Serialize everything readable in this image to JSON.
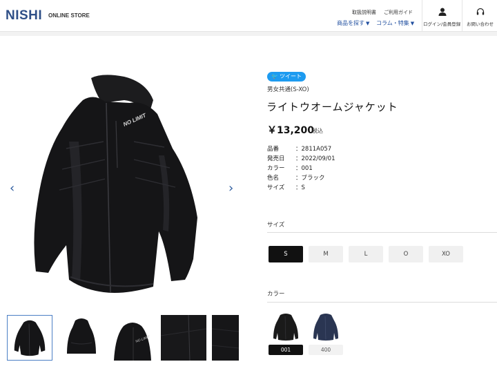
{
  "header": {
    "logo": "NISHI",
    "logo_sub": "ONLINE STORE",
    "links": [
      "取扱説明書",
      "ご利用ガイド"
    ],
    "nav": [
      "商品を探す",
      "コラム・特集"
    ],
    "login_label": "ログイン/会員登録",
    "contact_label": "お問い合わせ"
  },
  "gallery": {
    "prev_arrow": "‹",
    "next_arrow": "›",
    "logo_text": "NO LIMIT",
    "thumbnail_count": 5,
    "selected_thumbnail": 1
  },
  "product": {
    "tweet_label": "ツイート",
    "category": "男女共通(S-XO)",
    "title": "ライトウオームジャケット",
    "price": "￥13,200",
    "tax_label": "税込",
    "specs": [
      {
        "key": "品番",
        "value": "：2811A057"
      },
      {
        "key": "発売日",
        "value": "：2022/09/01"
      },
      {
        "key": "カラー",
        "value": "：001"
      },
      {
        "key": "色名",
        "value": "：ブラック"
      },
      {
        "key": "サイズ",
        "value": "：S"
      }
    ],
    "size_section_label": "サイズ",
    "sizes": [
      "S",
      "M",
      "L",
      "O",
      "XO"
    ],
    "selected_size": "S",
    "color_section_label": "カラー",
    "colors": [
      {
        "code": "001",
        "name": "ブラック",
        "hex": "#1a1a1a",
        "selected": true
      },
      {
        "code": "400",
        "name": "ネイビー",
        "hex": "#2a3552",
        "selected": false
      }
    ]
  },
  "theme": {
    "brand_color": "#2f4f87",
    "nav_color": "#2250a0",
    "tweet_color": "#1d9bf0"
  }
}
